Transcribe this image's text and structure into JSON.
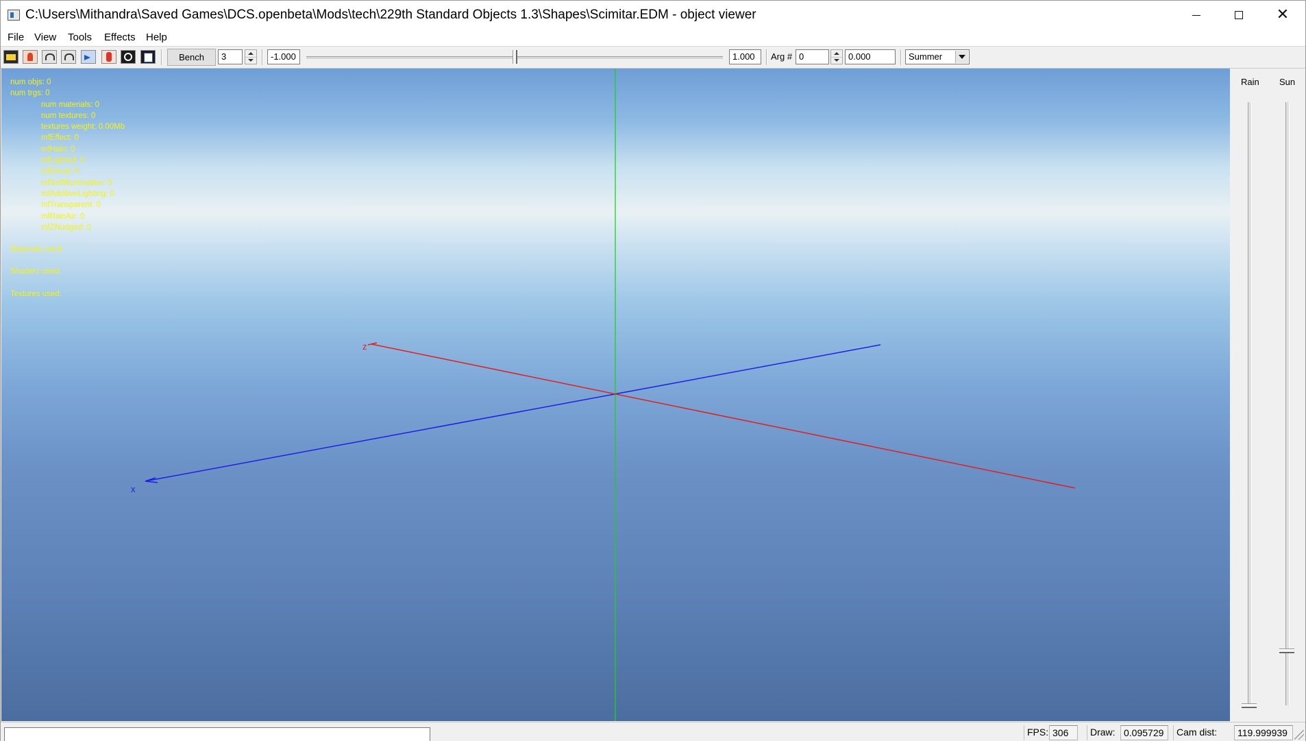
{
  "window": {
    "title": "C:\\Users\\Mithandra\\Saved Games\\DCS.openbeta\\Mods\\tech\\229th Standard Objects 1.3\\Shapes\\Scimitar.EDM - object viewer",
    "controls": {
      "minimize_icon": "minimize-icon",
      "maximize_icon": "maximize-icon",
      "close_icon": "close-icon"
    }
  },
  "menu": {
    "items": [
      {
        "label": "File"
      },
      {
        "label": "View"
      },
      {
        "label": "Tools"
      },
      {
        "label": "Effects"
      },
      {
        "label": "Help"
      }
    ]
  },
  "toolbar": {
    "icons": [
      "open-folder-icon",
      "run-man-icon",
      "undo-icon",
      "redo-icon",
      "forward-icon",
      "animation-man-icon",
      "zoom-icon",
      "pages-icon"
    ],
    "bench_label": "Bench",
    "bench_count": "3",
    "range_min": "-1.000",
    "range_max": "1.000",
    "slider_position": 0.5,
    "arg_label": "Arg #",
    "arg_value": "0",
    "arg_float": "0.000",
    "season": "Summer"
  },
  "viewport": {
    "stats": [
      {
        "text": "num objs: 0",
        "indent": false
      },
      {
        "text": "num trgs: 0",
        "indent": false
      },
      {
        "text": "num materials: 0",
        "indent": true
      },
      {
        "text": "num textures: 0",
        "indent": true
      },
      {
        "text": "textures weight: 0.00Mb",
        "indent": true
      },
      {
        "text": "mfEffect: 0",
        "indent": true
      },
      {
        "text": "mfHalo: 0",
        "indent": true
      },
      {
        "text": "mfLighted: 0",
        "indent": true
      },
      {
        "text": "mfDecal: 0",
        "indent": true
      },
      {
        "text": "mfSelfIllumination: 0",
        "indent": true
      },
      {
        "text": "mfAdditiveLighting: 0",
        "indent": true
      },
      {
        "text": "mfTransparent: 0",
        "indent": true
      },
      {
        "text": "mfRainAir: 0",
        "indent": true
      },
      {
        "text": "mfZNudged: 0",
        "indent": true
      }
    ],
    "sections": [
      {
        "text": "Materials used:"
      },
      {
        "text": "Shaders used:"
      },
      {
        "text": "Textures used:"
      }
    ],
    "axes": {
      "x_label": "x",
      "z_label": "z",
      "x_color": "#1f1fe0",
      "z_color": "#e01f1f",
      "y_color": "#1fd01f"
    }
  },
  "side_panel": {
    "rain_label": "Rain",
    "sun_label": "Sun",
    "rain_level": 0.0,
    "sun_level": 0.09
  },
  "status_bar": {
    "fps_label": "FPS:",
    "fps_value": "306",
    "draw_label": "Draw:",
    "draw_value": "0.095729",
    "cam_label": "Cam dist:",
    "cam_value": "119.999939"
  }
}
